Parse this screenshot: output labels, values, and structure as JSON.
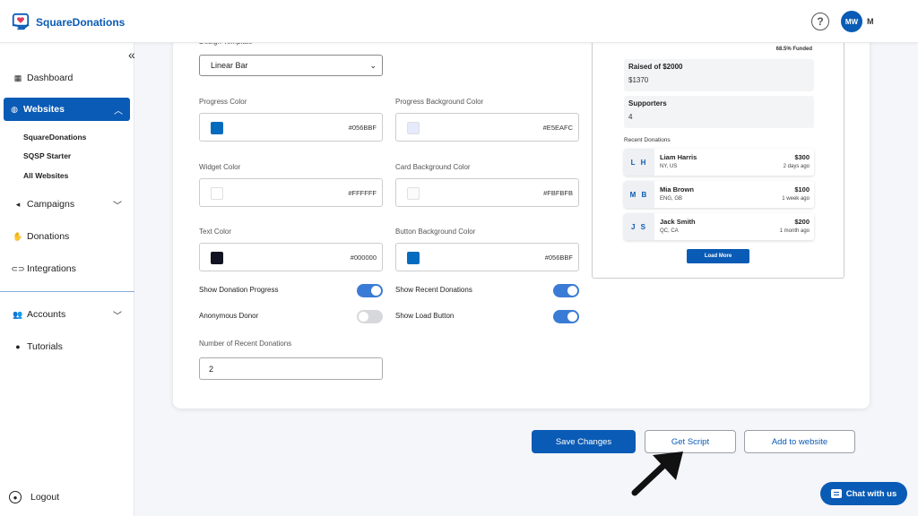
{
  "brand": {
    "name": "SquareDonations"
  },
  "header": {
    "help_icon": "?",
    "avatar_initials": "MW",
    "user_initial": "M"
  },
  "sidebar": {
    "collapse_icon": "«",
    "items": [
      {
        "label": "Dashboard",
        "icon": "grid-icon"
      },
      {
        "label": "Websites",
        "icon": "globe-icon"
      },
      {
        "label": "Campaigns",
        "icon": "megaphone-icon"
      },
      {
        "label": "Donations",
        "icon": "donation-hand-icon"
      },
      {
        "label": "Integrations",
        "icon": "link-icon"
      },
      {
        "label": "Accounts",
        "icon": "users-icon"
      },
      {
        "label": "Tutorials",
        "icon": "info-icon"
      }
    ],
    "sub_items": [
      "SquareDonations",
      "SQSP Starter",
      "All Websites"
    ],
    "logout": "Logout"
  },
  "form": {
    "design_template_label": "Design Template",
    "design_template_value": "Linear Bar",
    "progress_color_label": "Progress Color",
    "progress_color_value": "#056BBF",
    "progress_bg_label": "Progress Background Color",
    "progress_bg_value": "#E5EAFC",
    "widget_color_label": "Widget Color",
    "widget_color_value": "#FFFFFF",
    "card_bg_label": "Card Background Color",
    "card_bg_value": "#FBFBFB",
    "text_color_label": "Text Color",
    "text_color_value": "#000000",
    "button_bg_label": "Button Background Color",
    "button_bg_value": "#056BBF",
    "show_donation_progress": "Show Donation Progress",
    "show_recent_donations": "Show Recent Donations",
    "anonymous_donor": "Anonymous Donor",
    "show_load_button": "Show Load Button",
    "toggles": {
      "show_donation_progress": true,
      "show_recent_donations": true,
      "anonymous_donor": false,
      "show_load_button": true
    },
    "recent_count_label": "Number of Recent Donations",
    "recent_count_value": "2"
  },
  "preview": {
    "funded": "68.5% Funded",
    "raised_title": "Raised of $2000",
    "raised_value": "$1370",
    "supporters_title": "Supporters",
    "supporters_value": "4",
    "recent_title": "Recent Donations",
    "donations": [
      {
        "initials": "L H",
        "name": "Liam Harris",
        "location": "NY, US",
        "amount": "$300",
        "time": "2 days ago"
      },
      {
        "initials": "M B",
        "name": "Mia Brown",
        "location": "ENG, GB",
        "amount": "$100",
        "time": "1 week ago"
      },
      {
        "initials": "J S",
        "name": "Jack Smith",
        "location": "QC, CA",
        "amount": "$200",
        "time": "1 month ago"
      }
    ],
    "load_more": "Load More"
  },
  "actions": {
    "save": "Save Changes",
    "get_script": "Get Script",
    "add_to_website": "Add to website"
  },
  "chat": {
    "label": "Chat with us"
  },
  "colors": {
    "accent": "#0A5BB5",
    "text_swatch": "#111322"
  }
}
